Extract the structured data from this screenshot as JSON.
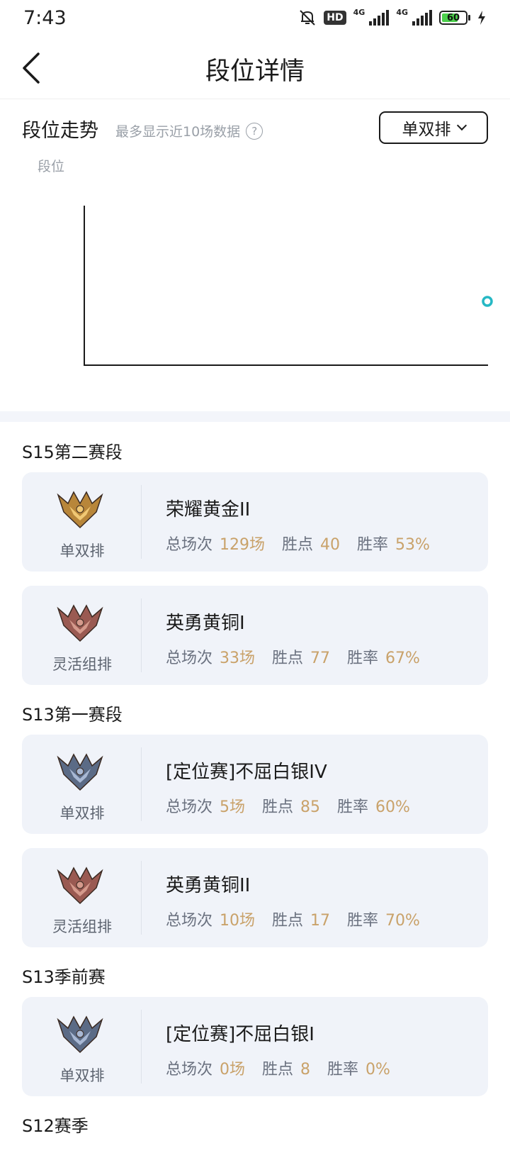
{
  "status_bar": {
    "time": "7:43",
    "hd": "HD",
    "net1": "4G",
    "net2": "4G",
    "battery": "60"
  },
  "header": {
    "title": "段位详情"
  },
  "trend": {
    "title": "段位走势",
    "note": "最多显示近10场数据",
    "help": "?",
    "queue_select": "单双排",
    "y_label": "段位",
    "accent": "#26b8c4"
  },
  "stat_labels": {
    "total": "总场次",
    "points": "胜点",
    "winrate": "胜率"
  },
  "seasons": [
    {
      "name": "S15第二赛段",
      "ranks": [
        {
          "queue": "单双排",
          "rank": "荣耀黄金II",
          "games": "129场",
          "points": "40",
          "winrate": "53%",
          "emblem": "gold"
        },
        {
          "queue": "灵活组排",
          "rank": "英勇黄铜I",
          "games": "33场",
          "points": "77",
          "winrate": "67%",
          "emblem": "bronze"
        }
      ]
    },
    {
      "name": "S13第一赛段",
      "ranks": [
        {
          "queue": "单双排",
          "rank": "[定位赛]不屈白银IV",
          "games": "5场",
          "points": "85",
          "winrate": "60%",
          "emblem": "silver"
        },
        {
          "queue": "灵活组排",
          "rank": "英勇黄铜II",
          "games": "10场",
          "points": "17",
          "winrate": "70%",
          "emblem": "bronze"
        }
      ]
    },
    {
      "name": "S13季前赛",
      "ranks": [
        {
          "queue": "单双排",
          "rank": "[定位赛]不屈白银I",
          "games": "0场",
          "points": "8",
          "winrate": "0%",
          "emblem": "silver"
        }
      ]
    },
    {
      "name": "S12赛季",
      "ranks": []
    }
  ],
  "colors": {
    "value": "#c9a26a",
    "card_bg": "#f0f3f9",
    "gold": "#b8863a",
    "bronze": "#9a5a52",
    "silver": "#5b6b86"
  }
}
